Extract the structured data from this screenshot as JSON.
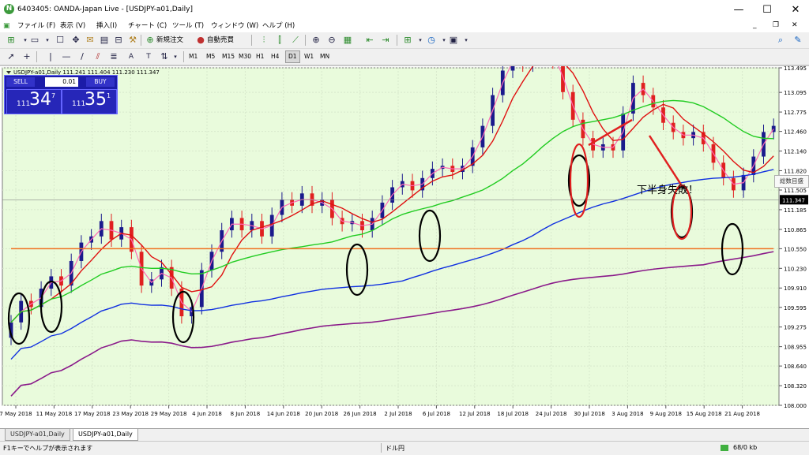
{
  "window": {
    "title": "6403405: OANDA-Japan Live - [USDJPY-a01,Daily]",
    "controls": [
      "—",
      "☐",
      "✕"
    ]
  },
  "menu": [
    "ファイル (F)",
    "表示 (V)",
    "挿入(I)",
    "チャート (C)",
    "ツール (T)",
    "ウィンドウ (W)",
    "ヘルプ (H)"
  ],
  "toolbar": {
    "new_order_label": "新規注文",
    "auto_trade_label": "自動売買"
  },
  "timeframes": [
    "M1",
    "M5",
    "M15",
    "M30",
    "H1",
    "H4",
    "D1",
    "W1",
    "MN"
  ],
  "selected_timeframe": "D1",
  "chart": {
    "header_text": "USDJPY-a01,Daily  111.241 111.404 111.230 111.347",
    "current_price": "111.347",
    "price_labels": [
      "113.495",
      "113.095",
      "112.775",
      "112.460",
      "112.140",
      "111.820",
      "111.505",
      "111.185",
      "110.865",
      "110.550",
      "110.230",
      "109.910",
      "109.595",
      "109.275",
      "108.955",
      "108.640",
      "108.320",
      "108.000"
    ],
    "date_labels": [
      "7 May 2018",
      "11 May 2018",
      "17 May 2018",
      "23 May 2018",
      "29 May 2018",
      "4 Jun 2018",
      "8 Jun 2018",
      "14 Jun 2018",
      "20 Jun 2018",
      "26 Jun 2018",
      "2 Jul 2018",
      "6 Jul 2018",
      "12 Jul 2018",
      "18 Jul 2018",
      "24 Jul 2018",
      "30 Jul 2018",
      "3 Aug 2018",
      "9 Aug 2018",
      "15 Aug 2018",
      "21 Aug 2018"
    ],
    "annotation": "下半身失敗！",
    "side_button": "総数目盛",
    "colors": {
      "bg": "#e9fbdc",
      "up": "#1a1a8c",
      "down": "#e02020",
      "ma_fast": "#ff69b4",
      "ma_red": "#e01010",
      "ma_green": "#22cc22",
      "ma_blue": "#1030e0",
      "ma_orange": "#f07020",
      "ma_purple": "#8a1a8a",
      "grid": "#d8e8cc"
    }
  },
  "trade_panel": {
    "sell_label": "SELL",
    "buy_label": "BUY",
    "lot": "0.01",
    "sell_price_small": "111",
    "sell_price_big": "34",
    "sell_price_sup": "7",
    "buy_price_small": "111",
    "buy_price_big": "35",
    "buy_price_sup": "1"
  },
  "tabs": [
    "USDJPY-a01,Daily",
    "USDJPY-a01,Daily"
  ],
  "status": {
    "help": "F1キーでヘルプが表示されます",
    "symbol": "ドル円",
    "traffic": "68/0 kb"
  }
}
